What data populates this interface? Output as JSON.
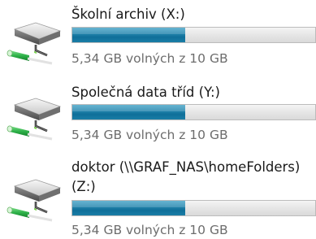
{
  "drives": [
    {
      "name": "Školní archiv (X:)",
      "free_text": "5,34 GB volných z 10 GB",
      "used_fraction": 0.466,
      "icon": "network-drive-icon"
    },
    {
      "name": "Společná data tříd (Y:)",
      "free_text": "5,34 GB volných z 10 GB",
      "used_fraction": 0.466,
      "icon": "network-drive-icon"
    },
    {
      "name": "doktor (\\\\GRAF_NAS\\homeFolders)",
      "name_line2": "(Z:)",
      "free_text": "5,34 GB volných z 10 GB",
      "used_fraction": 0.466,
      "icon": "network-drive-icon"
    }
  ],
  "colors": {
    "bar_fill": "#1a7da6",
    "bar_track": "#e6e6e6",
    "free_text": "#6d6d6d",
    "connector_green": "#2fb24a"
  }
}
